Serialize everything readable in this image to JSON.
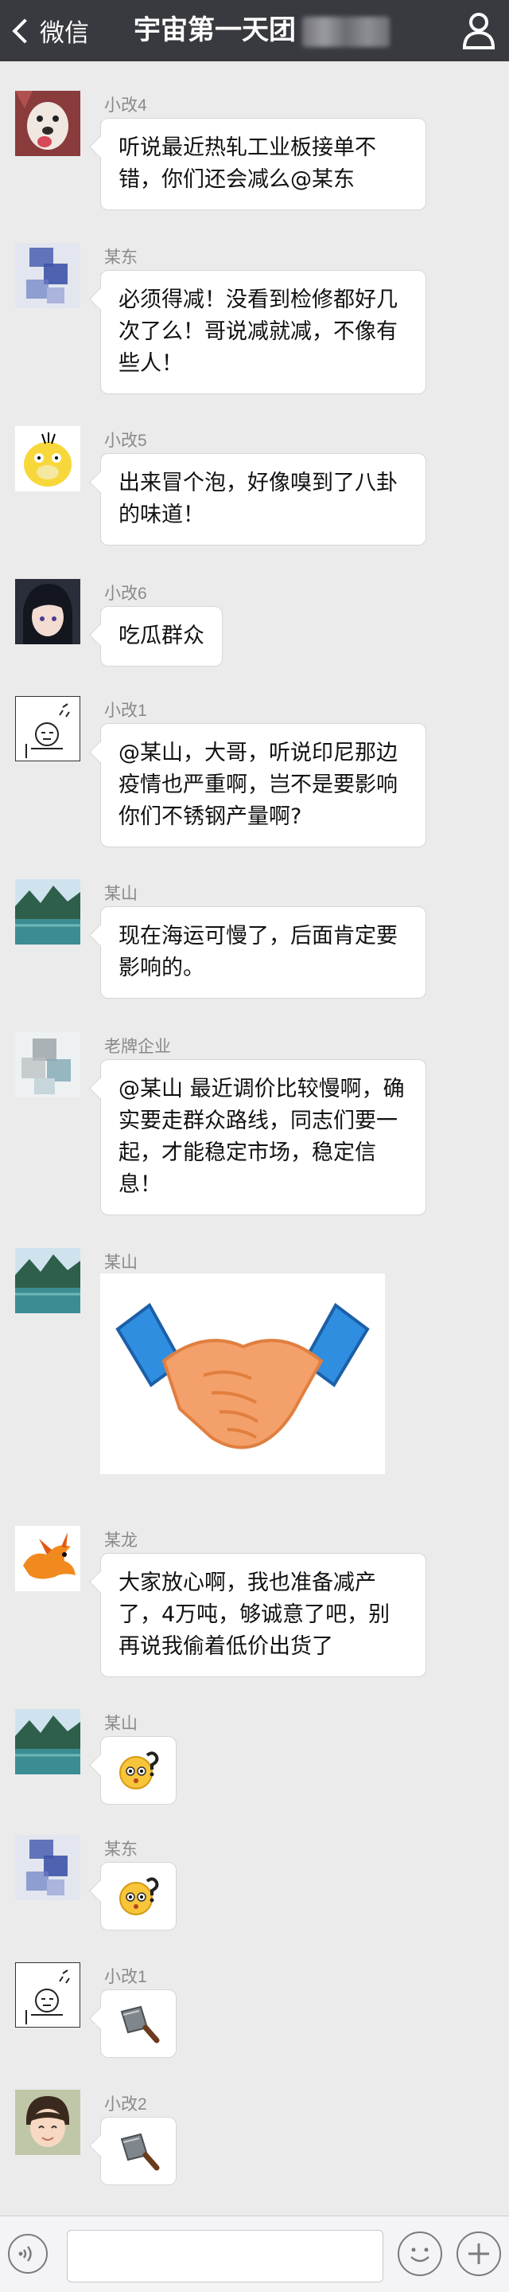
{
  "header": {
    "back_label": "微信",
    "title": "宇宙第一天团",
    "back_icon": "chevron-left-icon",
    "profile_icon": "person-icon"
  },
  "messages": [
    {
      "sender": "小改4",
      "text": "听说最近热轧工业板接单不错，你们还会减么@某东",
      "avatar": "dog-avatar"
    },
    {
      "sender": "某东",
      "text": "必须得减！没看到检修都好几次了么！哥说减就减，不像有些人！",
      "avatar": "blurred-avatar"
    },
    {
      "sender": "小改5",
      "text": "出来冒个泡，好像嗅到了八卦的味道！",
      "avatar": "duck-avatar"
    },
    {
      "sender": "小改6",
      "text": "吃瓜群众",
      "avatar": "anime-avatar"
    },
    {
      "sender": "小改1",
      "text": "@某山，大哥，听说印尼那边疫情也严重啊，岂不是要影响你们不锈钢产量啊?",
      "avatar": "sketch-avatar"
    },
    {
      "sender": "某山",
      "text": "现在海运可慢了，后面肯定要影响的。",
      "avatar": "lake-avatar"
    },
    {
      "sender": "老牌企业",
      "text": "@某山 最近调价比较慢啊，确实要走群众路线，同志们要一起，才能稳定市场，稳定信息！",
      "avatar": "blurred-avatar"
    },
    {
      "sender": "某山",
      "image": "handshake-image",
      "avatar": "lake-avatar"
    },
    {
      "sender": "某龙",
      "text": "大家放心啊，我也准备减产了，4万吨，够诚意了吧，别再说我偷着低价出货了",
      "avatar": "dragon-avatar"
    },
    {
      "sender": "某山",
      "emoji": "confused-emoji-icon",
      "avatar": "lake-avatar"
    },
    {
      "sender": "某东",
      "emoji": "confused-emoji-icon",
      "avatar": "blurred-avatar"
    },
    {
      "sender": "小改1",
      "emoji": "cleaver-icon",
      "avatar": "sketch-avatar"
    },
    {
      "sender": "小改2",
      "emoji": "cleaver-icon",
      "avatar": "boy-avatar"
    }
  ],
  "input_bar": {
    "voice_icon": "voice-icon",
    "emoji_icon": "smiley-icon",
    "more_icon": "plus-icon",
    "input_value": ""
  },
  "colors": {
    "header_bg": "#393a3f",
    "chat_bg": "#ebebeb",
    "bubble_bg": "#ffffff",
    "name_text": "#8a8a8a"
  }
}
